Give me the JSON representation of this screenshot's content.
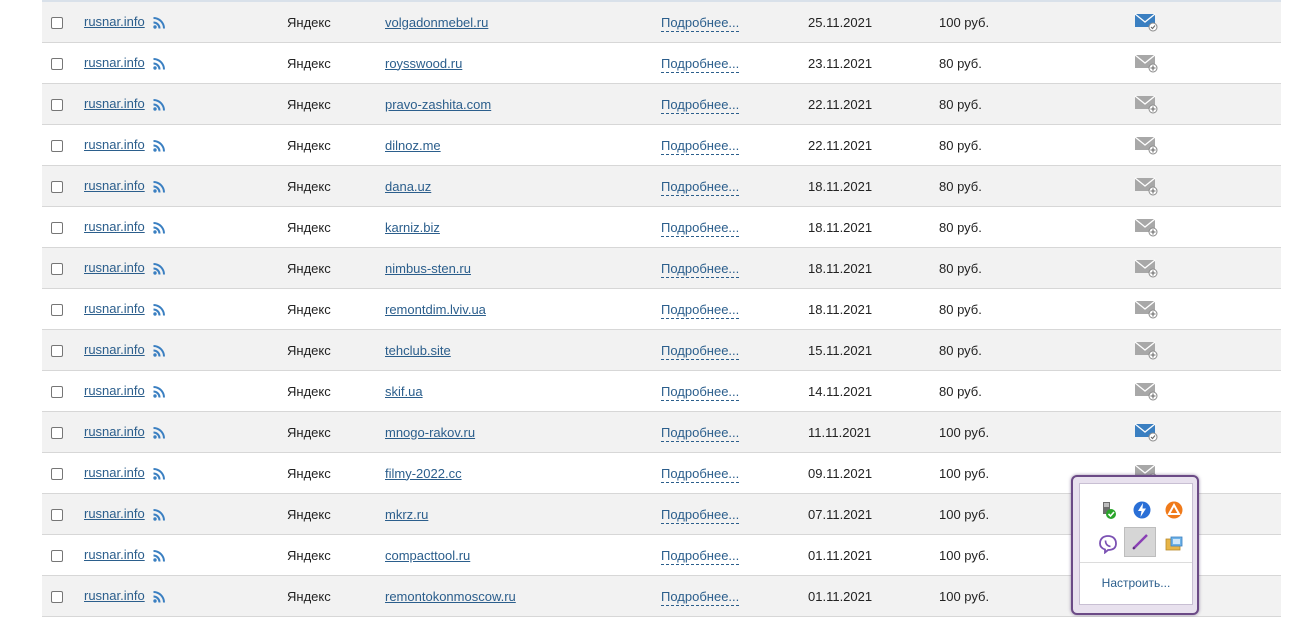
{
  "table": {
    "rows": [
      {
        "site": "rusnar.info",
        "engine": "Яндекс",
        "domain": "volgadonmebel.ru",
        "more": "Подробнее...",
        "date": "25.11.2021",
        "price": "100 руб.",
        "mail": "sent"
      },
      {
        "site": "rusnar.info",
        "engine": "Яндекс",
        "domain": "roysswood.ru",
        "more": "Подробнее...",
        "date": "23.11.2021",
        "price": "80 руб.",
        "mail": "add"
      },
      {
        "site": "rusnar.info",
        "engine": "Яндекс",
        "domain": "pravo-zashita.com",
        "more": "Подробнее...",
        "date": "22.11.2021",
        "price": "80 руб.",
        "mail": "add"
      },
      {
        "site": "rusnar.info",
        "engine": "Яндекс",
        "domain": "dilnoz.me",
        "more": "Подробнее...",
        "date": "22.11.2021",
        "price": "80 руб.",
        "mail": "add"
      },
      {
        "site": "rusnar.info",
        "engine": "Яндекс",
        "domain": "dana.uz",
        "more": "Подробнее...",
        "date": "18.11.2021",
        "price": "80 руб.",
        "mail": "add"
      },
      {
        "site": "rusnar.info",
        "engine": "Яндекс",
        "domain": "karniz.biz",
        "more": "Подробнее...",
        "date": "18.11.2021",
        "price": "80 руб.",
        "mail": "add"
      },
      {
        "site": "rusnar.info",
        "engine": "Яндекс",
        "domain": "nimbus-sten.ru",
        "more": "Подробнее...",
        "date": "18.11.2021",
        "price": "80 руб.",
        "mail": "add"
      },
      {
        "site": "rusnar.info",
        "engine": "Яндекс",
        "domain": "remontdim.lviv.ua",
        "more": "Подробнее...",
        "date": "18.11.2021",
        "price": "80 руб.",
        "mail": "add"
      },
      {
        "site": "rusnar.info",
        "engine": "Яндекс",
        "domain": "tehclub.site",
        "more": "Подробнее...",
        "date": "15.11.2021",
        "price": "80 руб.",
        "mail": "add"
      },
      {
        "site": "rusnar.info",
        "engine": "Яндекс",
        "domain": "skif.ua",
        "more": "Подробнее...",
        "date": "14.11.2021",
        "price": "80 руб.",
        "mail": "add"
      },
      {
        "site": "rusnar.info",
        "engine": "Яндекс",
        "domain": "mnogo-rakov.ru",
        "more": "Подробнее...",
        "date": "11.11.2021",
        "price": "100 руб.",
        "mail": "sent"
      },
      {
        "site": "rusnar.info",
        "engine": "Яндекс",
        "domain": "filmy-2022.cc",
        "more": "Подробнее...",
        "date": "09.11.2021",
        "price": "100 руб.",
        "mail": "add"
      },
      {
        "site": "rusnar.info",
        "engine": "Яндекс",
        "domain": "mkrz.ru",
        "more": "Подробнее...",
        "date": "07.11.2021",
        "price": "100 руб.",
        "mail": "hidden"
      },
      {
        "site": "rusnar.info",
        "engine": "Яндекс",
        "domain": "compacttool.ru",
        "more": "Подробнее...",
        "date": "01.11.2021",
        "price": "100 руб.",
        "mail": "hidden"
      },
      {
        "site": "rusnar.info",
        "engine": "Яндекс",
        "domain": "remontokonmoscow.ru",
        "more": "Подробнее...",
        "date": "01.11.2021",
        "price": "100 руб.",
        "mail": "hidden"
      }
    ]
  },
  "tray": {
    "icons": [
      "usb-safe-remove-icon",
      "bolt-icon",
      "avast-icon",
      "viber-icon",
      "pen-icon",
      "network-folder-icon"
    ],
    "customize_label": "Настроить..."
  },
  "colors": {
    "link": "#2b5e8c",
    "row_alt": "#f2f2f2",
    "mail_sent": "#3a7fc1",
    "mail_add": "#a8a8a8",
    "tray_border": "#6b4a86"
  }
}
